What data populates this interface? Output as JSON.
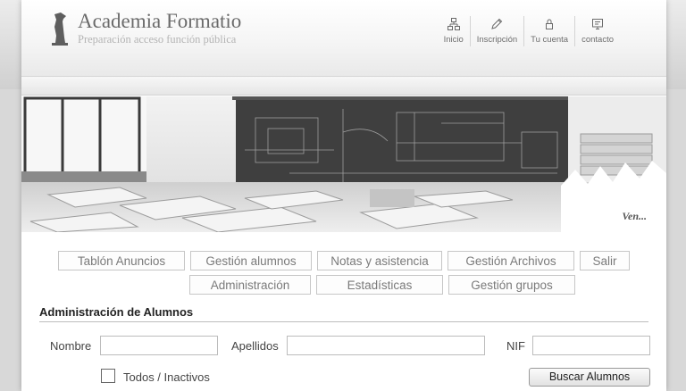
{
  "brand": {
    "title": "Academia Formatio",
    "subtitle": "Preparación acceso función pública"
  },
  "topnav": [
    {
      "label": "Inicio",
      "icon": "sitemap-icon"
    },
    {
      "label": "Inscripción",
      "icon": "pencil-icon"
    },
    {
      "label": "Tu cuenta",
      "icon": "lock-icon"
    },
    {
      "label": "contacto",
      "icon": "monitor-icon"
    }
  ],
  "banner": {
    "link": "Ven..."
  },
  "menu": {
    "row1": [
      "Tablón Anuncios",
      "Gestión alumnos",
      "Notas y asistencia",
      "Gestión Archivos",
      "Salir"
    ],
    "row2": [
      "Administración",
      "Estadísticas",
      "Gestión grupos"
    ]
  },
  "section": {
    "title": "Administración de Alumnos"
  },
  "form": {
    "nombre_label": "Nombre",
    "nombre_value": "",
    "apellidos_label": "Apellidos",
    "apellidos_value": "",
    "nif_label": "NIF",
    "nif_value": "",
    "todos_label": "Todos / Inactivos",
    "search_label": "Buscar Alumnos"
  }
}
